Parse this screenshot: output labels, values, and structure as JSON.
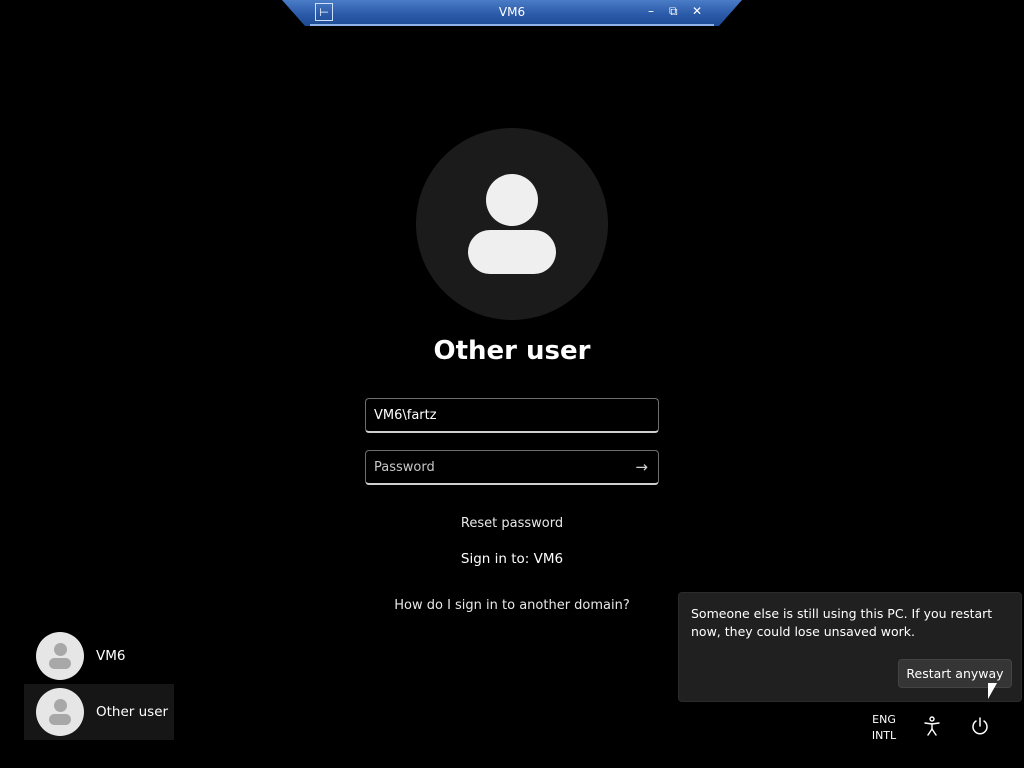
{
  "connection_bar": {
    "title": "VM6",
    "pin_icon": "pin-icon",
    "controls": [
      "minimize-icon",
      "restore-icon",
      "close-icon"
    ]
  },
  "login": {
    "title": "Other user",
    "username_value": "VM6\\fartz",
    "password_placeholder": "Password",
    "submit_icon": "arrow-right-icon",
    "reset_password": "Reset password",
    "sign_in_to": "Sign in to: VM6",
    "other_domain": "How do I sign in to another domain?"
  },
  "users": [
    {
      "name": "VM6"
    },
    {
      "name": "Other user",
      "selected": true
    }
  ],
  "flyout": {
    "message": "Someone else is still using this PC. If you restart now, they could lose unsaved work.",
    "button": "Restart anyway"
  },
  "tray": {
    "lang_line1": "ENG",
    "lang_line2": "INTL",
    "icons": [
      "accessibility-icon",
      "power-icon"
    ]
  },
  "colors": {
    "background": "#000000",
    "connection_bar": "#2b5aa8",
    "flyout_bg": "#202020",
    "avatar_bg": "#1b1b1b"
  }
}
